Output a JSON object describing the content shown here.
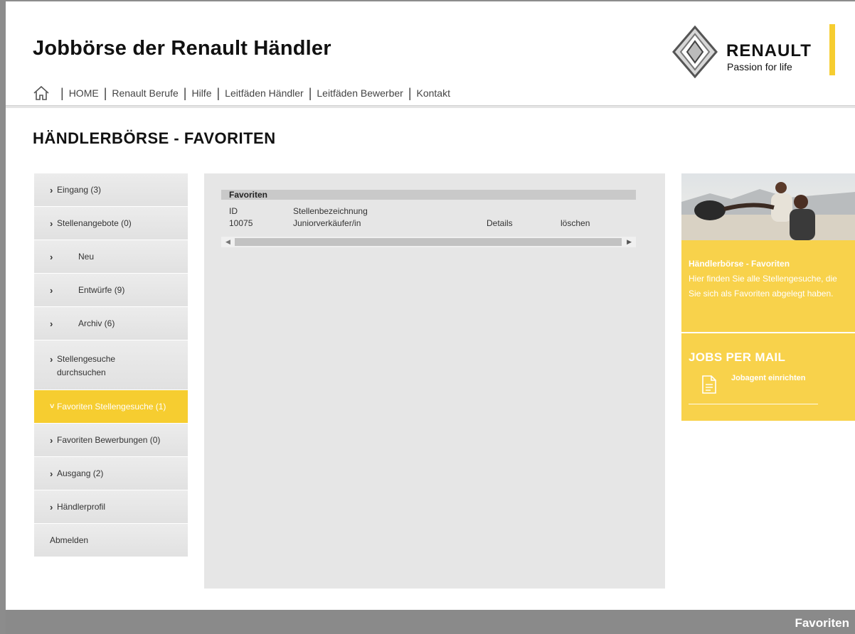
{
  "header": {
    "site_title": "Jobbörse der Renault Händler",
    "brand": {
      "word": "RENAULT",
      "tagline": "Passion for life"
    },
    "accent_color": "#f6cd30"
  },
  "nav": {
    "home_icon": "home-icon",
    "items": [
      "HOME",
      "Renault Berufe",
      "Hilfe",
      "Leitfäden Händler",
      "Leitfäden Bewerber",
      "Kontakt"
    ]
  },
  "page_title": "HÄNDLERBÖRSE - FAVORITEN",
  "sidebar": {
    "items": [
      {
        "label": "Eingang (3)"
      },
      {
        "label": "Stellenangebote (0)"
      },
      {
        "label": "Neu"
      },
      {
        "label": "Entwürfe (9)"
      },
      {
        "label": "Archiv (6)"
      },
      {
        "label": "Stellengesuche durchsuchen"
      },
      {
        "label": "Favoriten Stellengesuche (1)"
      },
      {
        "label": "Favoriten Bewerbungen (0)"
      },
      {
        "label": "Ausgang (2)"
      },
      {
        "label": "Händlerprofil"
      },
      {
        "label": "Abmelden"
      }
    ]
  },
  "favorites": {
    "heading": "Favoriten",
    "columns": {
      "id": "ID",
      "title": "Stellenbezeichnung"
    },
    "rows": [
      {
        "id": "10075",
        "title": "Juniorverkäufer/in",
        "details": "Details",
        "delete": "löschen"
      }
    ]
  },
  "info": {
    "title": "Händlerbörse - Favoriten",
    "text": "Hier finden Sie alle Stellengesuche, die Sie sich als Favoriten abgelegt haben."
  },
  "jobs_mail": {
    "title": "JOBS PER MAIL",
    "link": "Jobagent einrichten",
    "icon": "document-icon"
  },
  "footer": {
    "label": "Favoriten"
  }
}
